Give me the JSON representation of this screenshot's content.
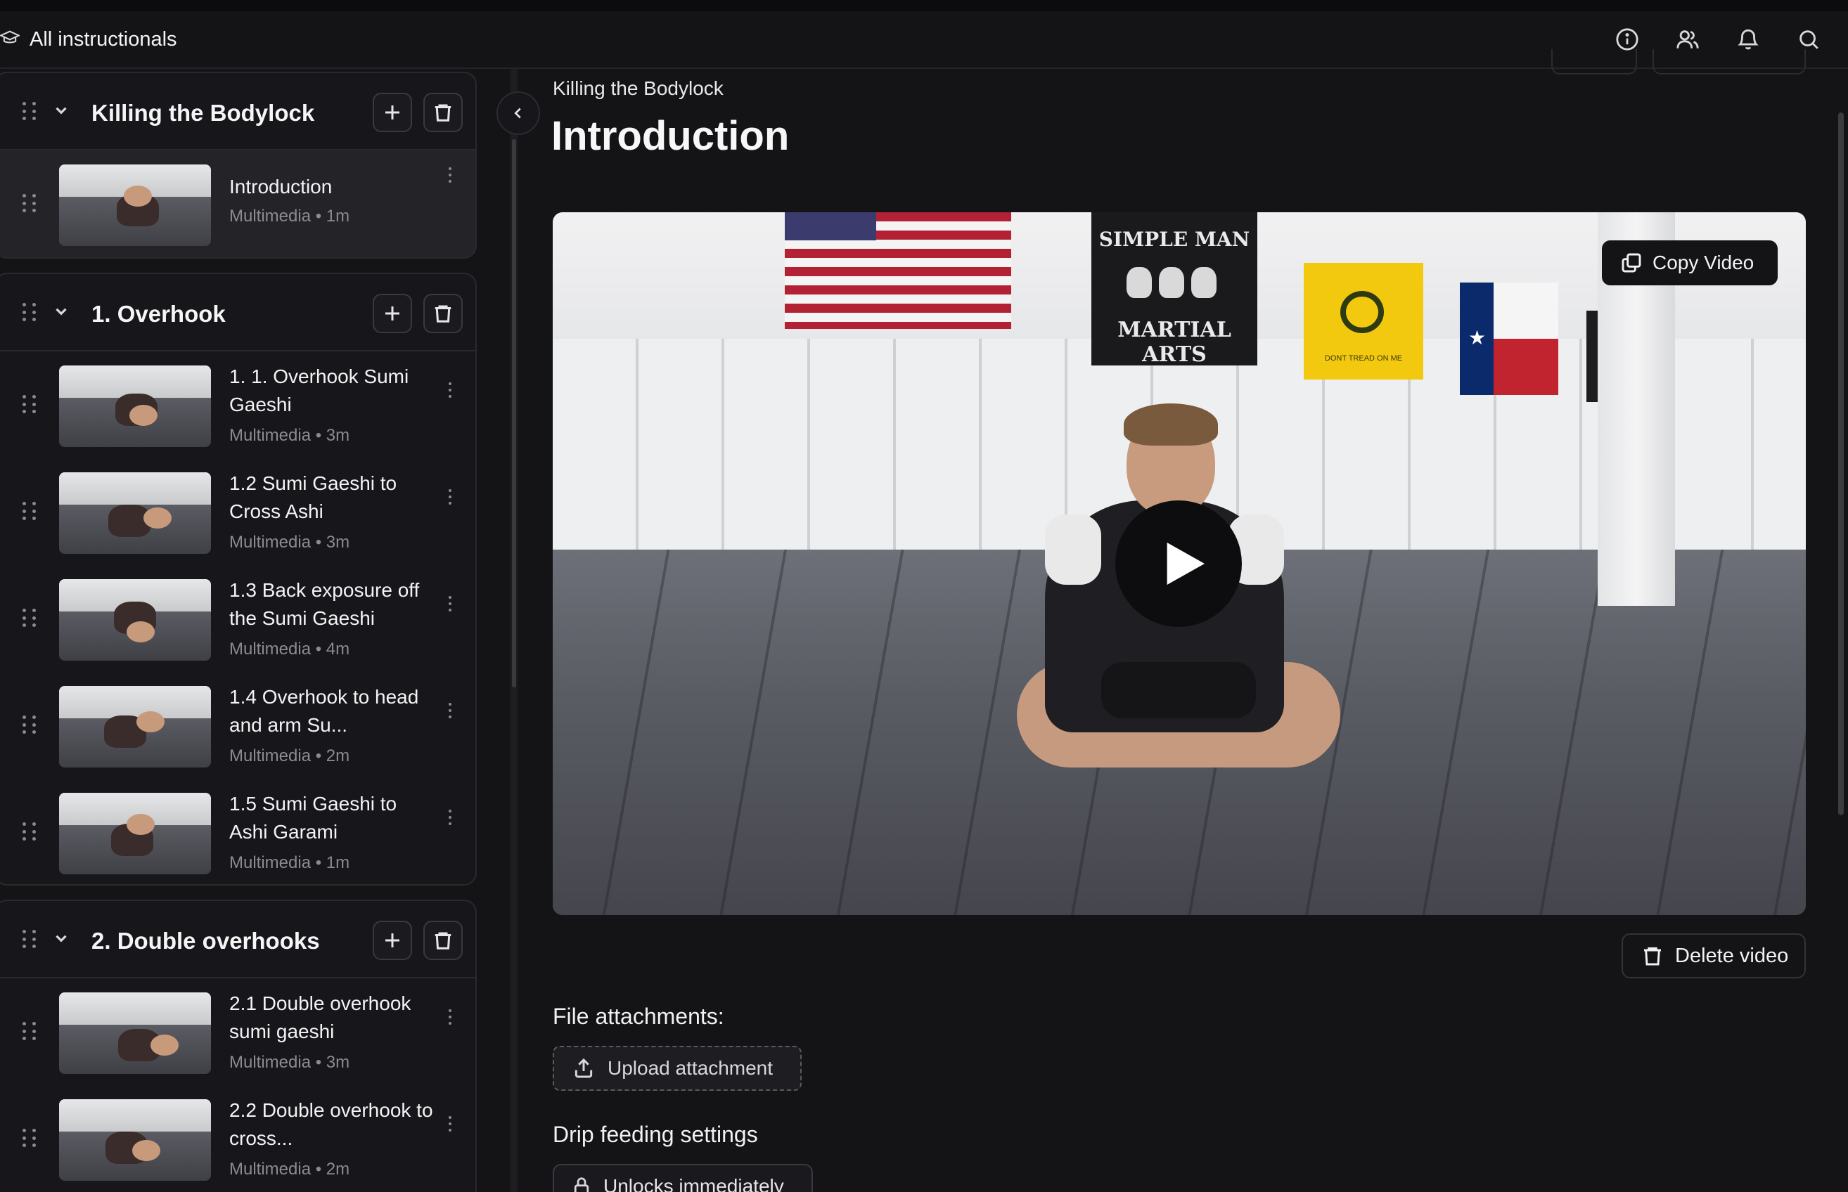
{
  "header": {
    "home_label": "All instructionals",
    "icons": [
      "info-icon",
      "users-icon",
      "bell-icon",
      "search-icon"
    ]
  },
  "sidebar": {
    "sections": [
      {
        "title": "Killing the Bodylock",
        "lessons": [
          {
            "title": "Introduction",
            "meta": "Multimedia • 1m",
            "active": true
          }
        ]
      },
      {
        "title": "1. Overhook",
        "lessons": [
          {
            "title": "1. 1. Overhook Sumi Gaeshi",
            "meta": "Multimedia • 3m"
          },
          {
            "title": "1.2 Sumi Gaeshi to Cross Ashi",
            "meta": "Multimedia • 3m"
          },
          {
            "title": "1.3 Back exposure off the Sumi Gaeshi",
            "meta": "Multimedia • 4m"
          },
          {
            "title": "1.4 Overhook to head and arm Su...",
            "meta": "Multimedia • 2m"
          },
          {
            "title": "1.5 Sumi Gaeshi to Ashi Garami",
            "meta": "Multimedia • 1m"
          }
        ]
      },
      {
        "title": "2. Double overhooks",
        "lessons": [
          {
            "title": "2.1 Double overhook sumi gaeshi",
            "meta": "Multimedia • 3m"
          },
          {
            "title": "2.2 Double overhook to cross...",
            "meta": "Multimedia • 2m"
          }
        ]
      }
    ]
  },
  "main": {
    "breadcrumb": "Killing the Bodylock",
    "title": "Introduction",
    "video": {
      "copy_label": "Copy Video",
      "flag_text_top": "SIMPLE MAN",
      "flag_text_bottom": "MARTIAL ARTS",
      "gadsden_text": "DONT TREAD ON ME"
    },
    "delete_video_label": "Delete video",
    "attachments_heading": "File attachments:",
    "upload_label": "Upload attachment",
    "drip_heading": "Drip feeding settings",
    "unlock_label": "Unlocks immediately"
  }
}
